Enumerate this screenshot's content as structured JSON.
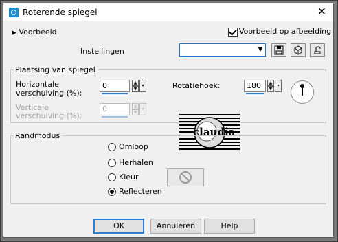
{
  "window": {
    "title": "Roterende spiegel",
    "close_glyph": "✕"
  },
  "preview": {
    "toggle_label": "Voorbeeld",
    "on_image_label": "Voorbeeld op afbeelding",
    "on_image_checked": true
  },
  "settings": {
    "label": "Instellingen",
    "value": ""
  },
  "placement": {
    "group_label": "Plaatsing van spiegel",
    "horizontal": {
      "label_line1": "Horizontale",
      "label_line2": "verschuiving (%):",
      "value": "0"
    },
    "vertical": {
      "label_line1": "Verticale",
      "label_line2": "verschuiving (%):",
      "value": "0"
    },
    "rotation": {
      "label": "Rotatiehoek:",
      "value": "180"
    }
  },
  "preview_image": {
    "watermark_text": "claudia"
  },
  "edge_mode": {
    "group_label": "Randmodus",
    "options": [
      {
        "label": "Omloop",
        "selected": false
      },
      {
        "label": "Herhalen",
        "selected": false
      },
      {
        "label": "Kleur",
        "selected": false
      },
      {
        "label": "Reflecteren",
        "selected": true
      }
    ]
  },
  "buttons": {
    "ok": "OK",
    "cancel": "Annuleren",
    "help": "Help"
  }
}
